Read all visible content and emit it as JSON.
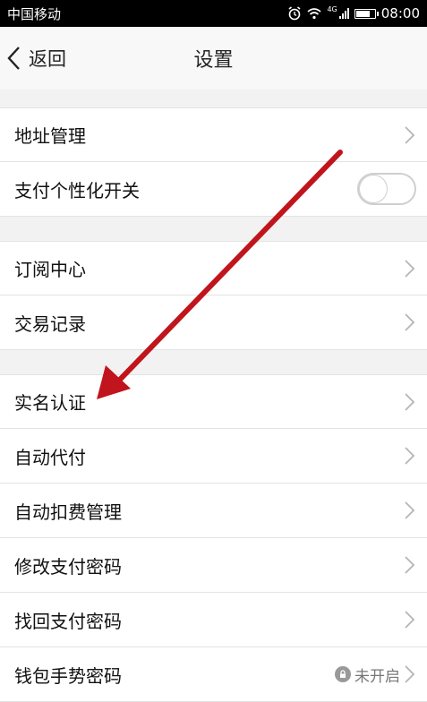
{
  "status_bar": {
    "carrier": "中国移动",
    "network_tag": "4G",
    "time": "08:00",
    "battery_level": 0.8,
    "icons": [
      "alarm-icon",
      "wifi-icon",
      "signal-icon",
      "battery-icon"
    ]
  },
  "nav": {
    "back_label": "返回",
    "title": "设置"
  },
  "groups": [
    {
      "items": [
        {
          "label": "地址管理",
          "trailing": "chevron"
        },
        {
          "label": "支付个性化开关",
          "trailing": "toggle",
          "toggle_on": false
        }
      ]
    },
    {
      "items": [
        {
          "label": "订阅中心",
          "trailing": "chevron"
        },
        {
          "label": "交易记录",
          "trailing": "chevron"
        }
      ]
    },
    {
      "items": [
        {
          "label": "实名认证",
          "trailing": "chevron"
        },
        {
          "label": "自动代付",
          "trailing": "chevron"
        },
        {
          "label": "自动扣费管理",
          "trailing": "chevron"
        },
        {
          "label": "修改支付密码",
          "trailing": "chevron"
        },
        {
          "label": "找回支付密码",
          "trailing": "chevron"
        },
        {
          "label": "钱包手势密码",
          "trailing": "status",
          "status_text": "未开启"
        }
      ]
    }
  ],
  "colors": {
    "annotation_arrow": "#c0151c",
    "background": "#f2f2f2",
    "row_background": "#ffffff",
    "status_bar": "#000000"
  }
}
